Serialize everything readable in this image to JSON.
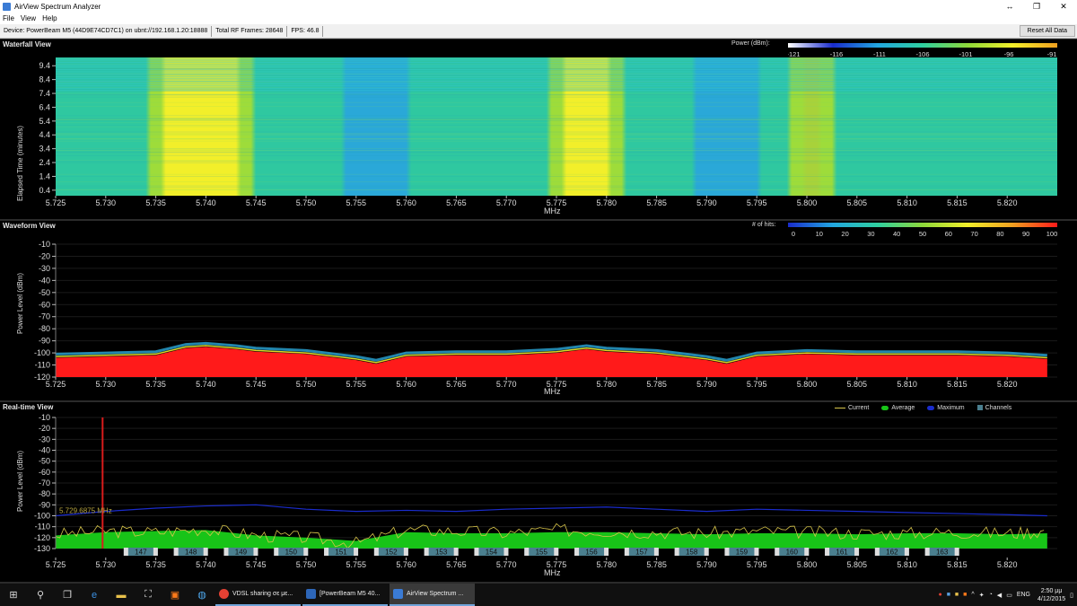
{
  "window": {
    "title": "AirView Spectrum Analyzer",
    "controls": [
      "↔",
      "❐",
      "✕"
    ]
  },
  "menu": [
    "File",
    "View",
    "Help"
  ],
  "status": {
    "device": "Device: PowerBeam M5 (44D9E74CD7C1) on ubnt://192.168.1.20:18888",
    "frames": "Total RF Frames: 28648",
    "fps": "FPS: 46.8",
    "reset_label": "Reset All Data"
  },
  "waterfall": {
    "title": "Waterfall View",
    "legend_label": "Power (dBm):",
    "legend_ticks": [
      "-121",
      "-116",
      "-111",
      "-106",
      "-101",
      "-96",
      "-91"
    ],
    "ylabel": "Elapsed Time (minutes)",
    "yticks": [
      "9.4",
      "8.4",
      "7.4",
      "6.4",
      "5.4",
      "4.4",
      "3.4",
      "2.4",
      "1.4",
      "0.4"
    ]
  },
  "waveform": {
    "title": "Waveform View",
    "legend_label": "# of hits:",
    "legend_ticks": [
      "0",
      "10",
      "20",
      "30",
      "40",
      "50",
      "60",
      "70",
      "80",
      "90",
      "100"
    ],
    "ylabel": "Power Level (dBm)",
    "yticks": [
      "-10",
      "-20",
      "-30",
      "-40",
      "-50",
      "-60",
      "-70",
      "-80",
      "-90",
      "-100",
      "-110",
      "-120"
    ]
  },
  "realtime": {
    "title": "Real-time View",
    "legend": [
      "Current",
      "Average",
      "Maximum",
      "Channels"
    ],
    "ylabel": "Power Level (dBm)",
    "yticks": [
      "-10",
      "-20",
      "-30",
      "-40",
      "-50",
      "-60",
      "-70",
      "-80",
      "-90",
      "-100",
      "-110",
      "-120",
      "-130"
    ],
    "marker_label": "5.729.6875 MHz",
    "channels": [
      "147",
      "148",
      "149",
      "150",
      "151",
      "152",
      "153",
      "154",
      "155",
      "156",
      "157",
      "158",
      "159",
      "160",
      "161",
      "162",
      "163"
    ]
  },
  "x_axis": {
    "label": "MHz",
    "ticks": [
      "5.725",
      "5.730",
      "5.735",
      "5.740",
      "5.745",
      "5.750",
      "5.755",
      "5.760",
      "5.765",
      "5.770",
      "5.775",
      "5.780",
      "5.785",
      "5.790",
      "5.795",
      "5.800",
      "5.805",
      "5.810",
      "5.815",
      "5.820"
    ]
  },
  "colors": {
    "current": "#d8c64a",
    "average": "#18c418",
    "maximum": "#1a2ccc",
    "channels": "#4a7f8f",
    "hits_fill": "#ff1a1a",
    "marker": "#d81c1c"
  },
  "chart_data": [
    {
      "type": "heatmap",
      "title": "Waterfall View",
      "xlabel": "MHz",
      "ylabel": "Elapsed Time (minutes)",
      "xlim": [
        5.725,
        5.825
      ],
      "ylim": [
        0,
        10
      ],
      "colorbar_label": "Power (dBm):",
      "colorbar_range": [
        -121,
        -91
      ],
      "strong_bands_mhz": [
        [
          5.736,
          5.743
        ],
        [
          5.776,
          5.78
        ],
        [
          5.8,
          5.801
        ]
      ],
      "weak_bands_mhz": [
        [
          5.754,
          5.76
        ],
        [
          5.789,
          5.795
        ]
      ]
    },
    {
      "type": "area",
      "title": "Waveform View",
      "xlabel": "MHz",
      "ylabel": "Power Level (dBm)",
      "ylim": [
        -120,
        -10
      ],
      "colorbar_label": "# of hits:",
      "colorbar_range": [
        0,
        100
      ],
      "x": [
        5.725,
        5.73,
        5.735,
        5.738,
        5.74,
        5.743,
        5.745,
        5.75,
        5.755,
        5.757,
        5.76,
        5.765,
        5.77,
        5.775,
        5.778,
        5.78,
        5.785,
        5.79,
        5.792,
        5.795,
        5.8,
        5.805,
        5.81,
        5.815,
        5.82,
        5.824
      ],
      "values": [
        -104,
        -103,
        -102,
        -96,
        -95,
        -97,
        -99,
        -101,
        -106,
        -109,
        -103,
        -102,
        -102,
        -100,
        -97,
        -99,
        -101,
        -106,
        -109,
        -103,
        -101,
        -102,
        -102,
        -102,
        -103,
        -105
      ]
    },
    {
      "type": "line",
      "title": "Real-time View",
      "xlabel": "MHz",
      "ylabel": "Power Level (dBm)",
      "ylim": [
        -130,
        -10
      ],
      "x": [
        5.725,
        5.73,
        5.735,
        5.74,
        5.745,
        5.75,
        5.755,
        5.76,
        5.765,
        5.77,
        5.775,
        5.78,
        5.785,
        5.79,
        5.795,
        5.8,
        5.805,
        5.81,
        5.815,
        5.82,
        5.824
      ],
      "series": [
        {
          "name": "Current",
          "values": [
            -117,
            -114,
            -115,
            -112,
            -118,
            -120,
            -125,
            -113,
            -114,
            -116,
            -113,
            -114,
            -115,
            -116,
            -114,
            -115,
            -116,
            -116,
            -115,
            -116,
            -114
          ]
        },
        {
          "name": "Average",
          "values": [
            -118,
            -115,
            -114,
            -113,
            -118,
            -120,
            -123,
            -115,
            -116,
            -116,
            -115,
            -115,
            -116,
            -117,
            -116,
            -116,
            -117,
            -116,
            -116,
            -117,
            -116
          ]
        },
        {
          "name": "Maximum",
          "values": [
            -100,
            -96,
            -93,
            -91,
            -90,
            -94,
            -96,
            -95,
            -96,
            -94,
            -93,
            -92,
            -94,
            -96,
            -94,
            -95,
            -96,
            -97,
            -98,
            -99,
            -100
          ]
        }
      ],
      "channels": [
        "147",
        "148",
        "149",
        "150",
        "151",
        "152",
        "153",
        "154",
        "155",
        "156",
        "157",
        "158",
        "159",
        "160",
        "161",
        "162",
        "163"
      ]
    }
  ],
  "taskbar": {
    "apps": [
      {
        "label": "VDSL sharing σε με..."
      },
      {
        "label": "[PowerBeam M5 40..."
      },
      {
        "label": "AirView Spectrum ..."
      }
    ],
    "lang": "ENG",
    "time": "2:50 μμ",
    "date": "4/12/2015"
  }
}
